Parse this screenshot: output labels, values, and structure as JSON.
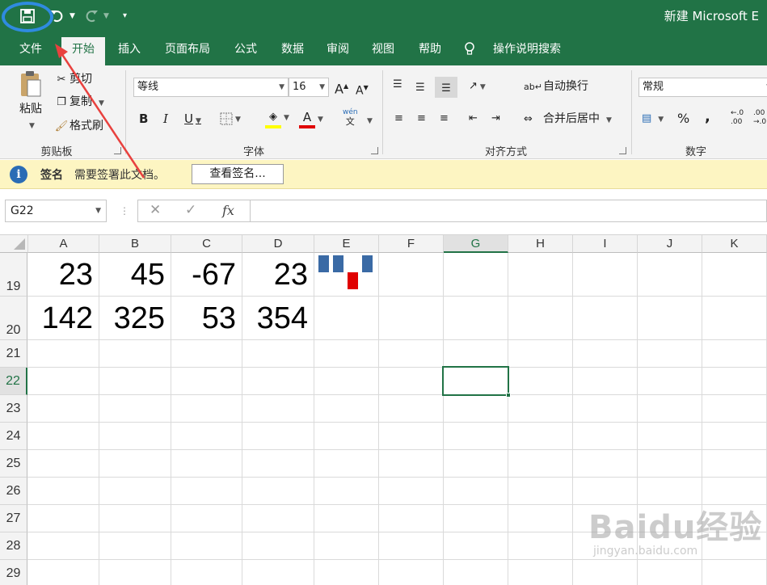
{
  "app": {
    "title": "新建 Microsoft E"
  },
  "qat": {
    "save_icon": "save-icon",
    "undo_icon": "undo-icon",
    "redo_icon": "redo-icon",
    "customize_icon": "customize-qat-icon"
  },
  "tabs": [
    {
      "label": "文件"
    },
    {
      "label": "开始"
    },
    {
      "label": "插入"
    },
    {
      "label": "页面布局"
    },
    {
      "label": "公式"
    },
    {
      "label": "数据"
    },
    {
      "label": "审阅"
    },
    {
      "label": "视图"
    },
    {
      "label": "帮助"
    },
    {
      "label": "操作说明搜索"
    }
  ],
  "ribbon": {
    "clipboard": {
      "label": "剪贴板",
      "paste": "粘贴",
      "cut": "剪切",
      "copy": "复制",
      "format_painter": "格式刷"
    },
    "font": {
      "label": "字体",
      "font_name": "等线",
      "font_size": "16",
      "bold": "B",
      "italic": "I",
      "underline": "U",
      "grow": "A",
      "shrink": "A",
      "phonetic_top": "wén",
      "phonetic_bottom": "文"
    },
    "alignment": {
      "label": "对齐方式",
      "wrap_text": "自动换行",
      "merge_center": "合并后居中"
    },
    "number": {
      "label": "数字",
      "format": "常规",
      "percent": "%",
      "comma": ",",
      "inc_decimal_top": "←.0",
      "inc_decimal_bottom": ".00",
      "dec_decimal_top": ".00",
      "dec_decimal_bottom": "→.0"
    }
  },
  "message_bar": {
    "title": "签名",
    "text": "需要签署此文档。",
    "button": "查看签名..."
  },
  "formula_bar": {
    "name_box": "G22",
    "cancel": "✕",
    "enter": "✓",
    "fx": "fx",
    "value": ""
  },
  "sheet": {
    "columns": [
      "A",
      "B",
      "C",
      "D",
      "E",
      "F",
      "G",
      "H",
      "I",
      "J",
      "K"
    ],
    "rows": [
      "19",
      "20",
      "21",
      "22",
      "23",
      "24",
      "25",
      "26",
      "27",
      "28",
      "29"
    ],
    "selected_cell": "G22",
    "row19": [
      "23",
      "45",
      "-67",
      "23"
    ],
    "row20": [
      "142",
      "325",
      "53",
      "354"
    ],
    "sparkline": {
      "cell": "E19",
      "type": "win-loss",
      "values": [
        23,
        45,
        -67,
        23
      ],
      "positive_color": "#3a6aa5",
      "negative_color": "#e00000"
    }
  },
  "colors": {
    "excel_green": "#217346",
    "annotation_blue": "#2f8be0",
    "annotation_red": "#e8413e"
  },
  "watermark": {
    "text": "Baidu经验",
    "url": "jingyan.baidu.com"
  }
}
